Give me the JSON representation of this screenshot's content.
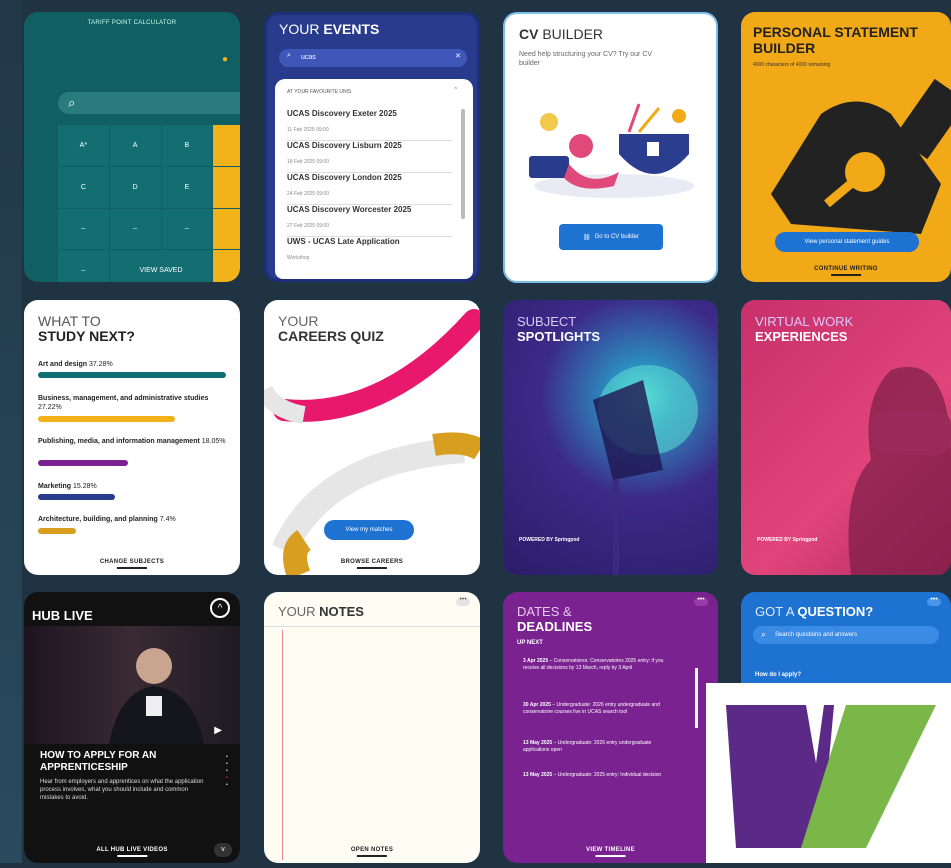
{
  "calc": {
    "title": "TARIFF POINT CALCULATOR",
    "grades": [
      "A*",
      "A",
      "B",
      "",
      "C",
      "D",
      "E",
      "",
      "–",
      "–",
      "–",
      "",
      "–",
      "",
      "",
      ""
    ],
    "view_label": "VIEW SAVED"
  },
  "events": {
    "title_prefix": "YOUR ",
    "title_bold": "EVENTS",
    "search_value": "ucas",
    "section": "AT YOUR FAVOURITE UNIS",
    "items": [
      {
        "name": "UCAS Discovery Exeter 2025",
        "sub": "11 Feb 2025 09:00"
      },
      {
        "name": "UCAS Discovery Lisburn 2025",
        "sub": "18 Feb 2025 09:00"
      },
      {
        "name": "UCAS Discovery London 2025",
        "sub": "24 Feb 2025 09:00"
      },
      {
        "name": "UCAS Discovery Worcester 2025",
        "sub": "27 Feb 2025 09:00"
      },
      {
        "name": "UWS - UCAS Late Application",
        "sub": "Workshop"
      }
    ]
  },
  "cv": {
    "title_bold": "CV",
    "title_rest": " BUILDER",
    "text": "Need help structuring your CV? Try our CV builder",
    "button": "Go to CV builder"
  },
  "ps": {
    "title": "PERSONAL STATEMENT BUILDER",
    "sub": "4000 characters of 4000 remaining",
    "button": "View personal statement guides",
    "link": "CONTINUE WRITING"
  },
  "wts": {
    "title_1": "WHAT TO",
    "title_2": "STUDY NEXT?",
    "items": [
      {
        "label": "Art and design",
        "pct": "37.28%",
        "color": "#0f6f73",
        "value": 100
      },
      {
        "label": "Business, management, and administrative studies",
        "pct": "27.22%",
        "color": "#f2b21a",
        "value": 73
      },
      {
        "label": "Publishing, media, and information management",
        "pct": "18.05%",
        "color": "#7a2290",
        "value": 48
      },
      {
        "label": "Marketing",
        "pct": "15.28%",
        "color": "#283b8c",
        "value": 41
      },
      {
        "label": "Architecture, building, and planning",
        "pct": "7.4%",
        "color": "#d89e1f",
        "value": 20
      }
    ],
    "link": "CHANGE SUBJECTS"
  },
  "cq": {
    "title_1": "YOUR",
    "title_2": "CAREERS QUIZ",
    "button": "View my matches",
    "link": "BROWSE CAREERS"
  },
  "sp": {
    "title_1": "SUBJECT",
    "title_2": "SPOTLIGHTS",
    "powered": "POWERED BY Springpod"
  },
  "vw": {
    "title_1": "VIRTUAL WORK",
    "title_2": "EXPERIENCES",
    "powered": "POWERED BY Springpod"
  },
  "hub": {
    "title": "HUB LIVE",
    "headline": "HOW TO APPLY FOR AN APPRENTICESHIP",
    "desc": "Hear from employers and apprentices on what the application process involves, what you should include and common mistakes to avoid.",
    "link": "ALL HUB LIVE VIDEOS"
  },
  "notes": {
    "title_prefix": "YOUR ",
    "title_bold": "NOTES",
    "link": "OPEN NOTES"
  },
  "dates": {
    "title_1": "DATES &",
    "title_2": "DEADLINES",
    "up_next": "UP NEXT",
    "items": [
      {
        "date": "3 Apr 2025",
        "text": "Conservatoires: Conservatoires 2025 entry: if you receive all decisions by 13 March, reply by 3 April"
      },
      {
        "date": "30 Apr 2025",
        "text": "Undergraduate: 2026 entry undergraduate and conservatoire courses live in UCAS search tool"
      },
      {
        "date": "13 May 2025",
        "text": "Undergraduate: 2026 entry undergraduate applications open"
      },
      {
        "date": "13 May 2025",
        "text": "Undergraduate: 2025 entry: Individual decision"
      }
    ],
    "link": "VIEW TIMELINE"
  },
  "gq": {
    "title_prefix": "GOT A ",
    "title_bold": "QUESTION?",
    "search_placeholder": "Search questions and answers",
    "first_q": "How do I apply?"
  },
  "colors": {
    "teal": "#0f5f63",
    "navy": "#283b8c",
    "yellow": "#f2a917",
    "purple": "#7a2290",
    "blue": "#1e73d2",
    "logo_purple": "#5b2a86",
    "logo_green": "#7ab648"
  }
}
